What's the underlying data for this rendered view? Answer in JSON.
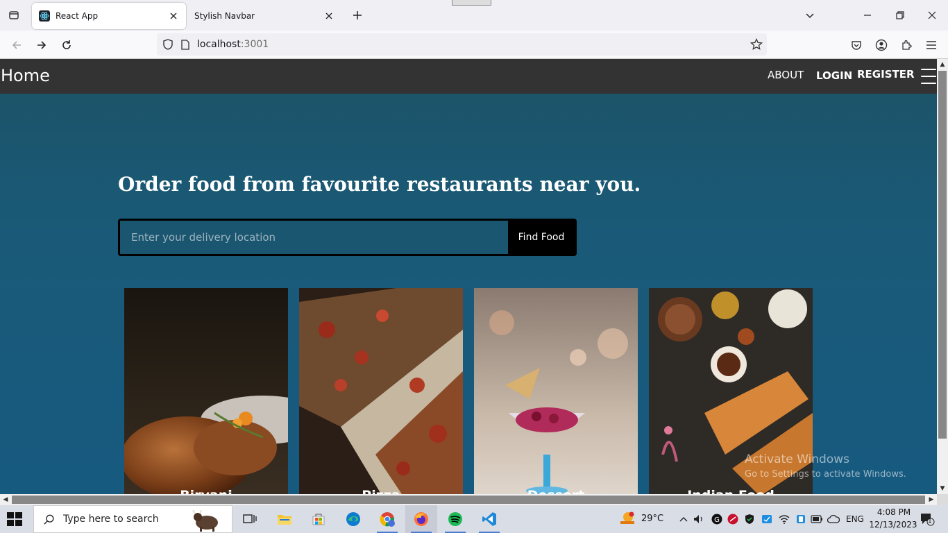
{
  "browser": {
    "tabs": [
      {
        "label": "React App",
        "active": true
      },
      {
        "label": "Stylish Navbar",
        "active": false
      }
    ],
    "url_host": "localhost",
    "url_port": ":3001"
  },
  "app": {
    "brand": "Home",
    "nav_links": [
      "ABOUT",
      "LOGIN",
      "REGISTER"
    ],
    "hero_title": "Order food from favourite restaurants near you.",
    "search_placeholder": "Enter your delivery location",
    "find_button": "Find Food",
    "categories": [
      "Biryani",
      "Pizza",
      "Dessert",
      "Indian Food"
    ]
  },
  "watermark": {
    "line1": "Activate Windows",
    "line2": "Go to Settings to activate Windows."
  },
  "taskbar": {
    "search_placeholder": "Type here to search",
    "weather_temp": "29°C",
    "language": "ENG",
    "time": "4:08 PM",
    "date": "12/13/2023",
    "notification_count": "1"
  }
}
